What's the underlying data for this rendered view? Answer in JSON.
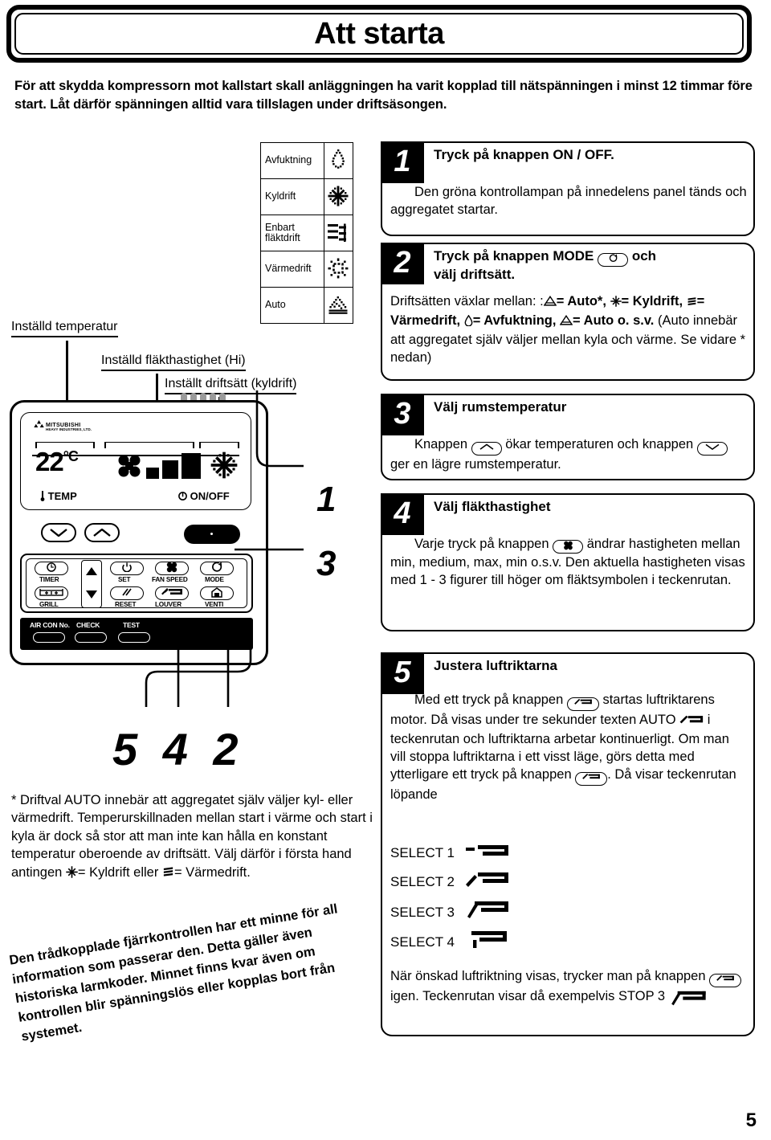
{
  "page": {
    "title": "Att starta",
    "page_number": "5",
    "intro": "För att skydda kompressorn mot kallstart skall anläggningen ha varit kopplad till nätspänningen i minst 12 timmar före start. Låt därför spänningen alltid vara tillslagen under driftsäsongen."
  },
  "mode_table": {
    "rows": [
      {
        "label": "Avfuktning",
        "icon": "droplet-icon"
      },
      {
        "label": "Kyldrift",
        "icon": "snowflake-icon"
      },
      {
        "label": "Enbart fläktdrift",
        "icon": "fan-lines-icon"
      },
      {
        "label": "Värmedrift",
        "icon": "sun-icon"
      },
      {
        "label": "Auto",
        "icon": "auto-icon"
      }
    ]
  },
  "diagram_labels": {
    "temperature": "Inställd temperatur",
    "fan_speed": "Inställd fläkthastighet (Hi)",
    "mode": "Inställt driftsätt (kyldrift)"
  },
  "remote": {
    "brand_line1": "MITSUBISHI",
    "brand_line2": "HEAVY INDUSTRIES, LTD.",
    "lcd_temperature": "22",
    "lcd_degree": "°C",
    "lcd_temp_label": "TEMP",
    "lcd_onoff_label": "ON/OFF",
    "buttons": [
      {
        "label": "TIMER",
        "icon": "clock-icon"
      },
      {
        "label": "GRILL",
        "icon": "grill-icon"
      },
      {
        "label": "SET",
        "icon": "power-icon"
      },
      {
        "label": "RESET",
        "icon": "slash-icon"
      },
      {
        "label": "FAN SPEED",
        "icon": "fan-icon"
      },
      {
        "label": "LOUVER",
        "icon": "louver-icon"
      },
      {
        "label": "MODE",
        "icon": "cycle-icon"
      },
      {
        "label": "VENTI",
        "icon": "house-icon"
      }
    ],
    "service_buttons": [
      {
        "label": "AIR CON No."
      },
      {
        "label": "CHECK"
      },
      {
        "label": "TEST"
      }
    ],
    "callout_digits_right": [
      "1",
      "3"
    ],
    "callout_digits_bottom": "5 4 2"
  },
  "steps": [
    {
      "num": "1",
      "head": "Tryck på knappen ON / OFF.",
      "body": "Den gröna kontrollampan på innedelens panel tänds och aggregatet startar."
    },
    {
      "num": "2",
      "head_line1": "Tryck på knappen MODE",
      "head_key": "cycle-icon",
      "head_line2": "och",
      "head_line3": "välj driftsätt.",
      "body_pre": "Driftsätten växlar mellan: :",
      "body_a": "= Auto*,",
      "body_b": "= Kyldrift,",
      "body_c": "= Värmedrift,",
      "body_d": "= Avfuktning,",
      "body_e": "= Auto",
      "body_f": "o. s.v.",
      "body_tail": "(Auto innebär att  aggregatet själv väljer mellan kyla och värme. Se vidare * nedan)"
    },
    {
      "num": "3",
      "head": "Välj rumstemperatur",
      "body_pre": "Knappen",
      "body_mid": "ökar temperaturen och knappen",
      "body_tail": "ger en lägre rumstemperatur.",
      "key_up": "up-arrow-icon",
      "key_down": "down-arrow-icon"
    },
    {
      "num": "4",
      "head": "Välj fläkthastighet",
      "body_pre": "Varje tryck på knappen",
      "body_tail": "ändrar hastigheten mellan min, medium, max, min o.s.v. Den aktuella hastigheten visas med 1 - 3 figurer till höger om fläktsymbolen i teckenrutan.",
      "key_fan": "fan-icon"
    },
    {
      "num": "5",
      "head": "Justera luftriktarna",
      "body_p1_a": "Med ett tryck på knappen",
      "body_p1_b": "startas luftriktarens motor.  Då visas under  tre sekunder texten AUTO",
      "body_p1_c": "i teckenrutan och luftriktarna arbetar kontinuerligt.  Om man vill stoppa luftriktarna i ett visst läge, görs detta med ytterligare ett tryck på knappen",
      "body_p1_d": ". Då visar teckenrutan löpande",
      "select_rows": [
        {
          "label": "SELECT  1",
          "icon": "louver-pos1-icon"
        },
        {
          "label": "SELECT  2",
          "icon": "louver-pos2-icon"
        },
        {
          "label": "SELECT  3",
          "icon": "louver-pos3-icon"
        },
        {
          "label": "SELECT  4",
          "icon": "louver-pos4-icon"
        }
      ],
      "body_p2_a": "När önskad luftriktning visas, trycker man på knappen",
      "body_p2_b": "igen. Teckenrutan visar då exempelvis STOP  3",
      "key_louver": "louver-icon"
    }
  ],
  "footnote": "* Driftval AUTO innebär att aggregatet själv väljer kyl- eller värmedrift. Temperurskillnaden mellan start i värme och start i kyla är dock så stor att man inte kan hålla en konstant temperatur oberoende av driftsätt. Välj därför i första hand antingen",
  "footnote_a": "= Kyldrift",
  "footnote_b": "eller",
  "footnote_c": "= Värmedrift.",
  "memo": "Den trådkopplade fjärrkontrollen har ett minne för all information som passerar den. Detta gäller även historiska larmkoder. Minnet finns kvar även om kontrollen blir spänningslös eller kopplas bort från systemet."
}
